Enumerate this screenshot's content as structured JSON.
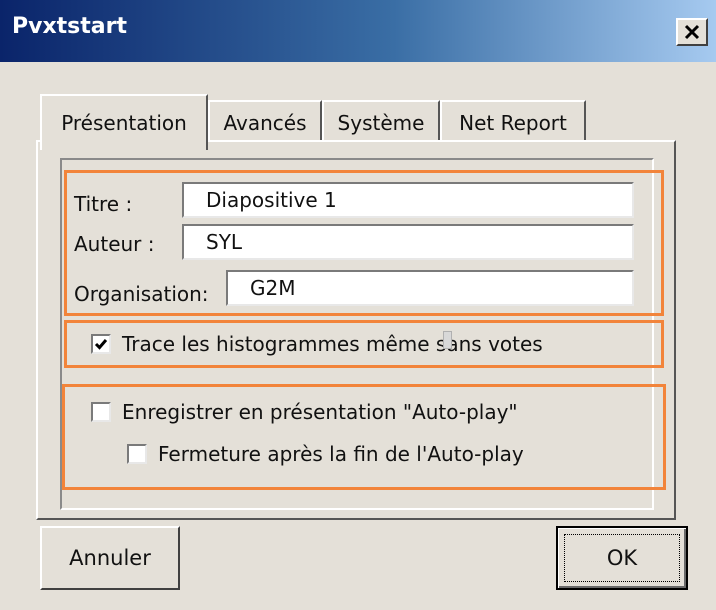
{
  "window": {
    "title": "Pvxtstart"
  },
  "tabs": [
    {
      "label": "Présentation",
      "active": true
    },
    {
      "label": "Avancés",
      "active": false
    },
    {
      "label": "Système",
      "active": false
    },
    {
      "label": "Net Report",
      "active": false
    }
  ],
  "form": {
    "titre": {
      "label": "Titre :",
      "value": "Diapositive 1"
    },
    "auteur": {
      "label": "Auteur :",
      "value": "SYL"
    },
    "organisation": {
      "label": "Organisation:",
      "value": "G2M"
    }
  },
  "options": {
    "histogrammes": {
      "label": "Trace les histogrammes même sans votes",
      "checked": true
    },
    "autoplay": {
      "label": "Enregistrer en présentation \"Auto-play\"",
      "checked": false
    },
    "fermeture": {
      "label": "Fermeture après la fin de l'Auto-play",
      "checked": false
    }
  },
  "buttons": {
    "cancel": "Annuler",
    "ok": "OK"
  },
  "colors": {
    "highlight": "#f2843a",
    "dialog_bg": "#e4e0d8",
    "titlebar_start": "#0a246a",
    "titlebar_end": "#a6caf0"
  },
  "icons": {
    "close": "close-icon",
    "check": "checkmark-icon"
  }
}
